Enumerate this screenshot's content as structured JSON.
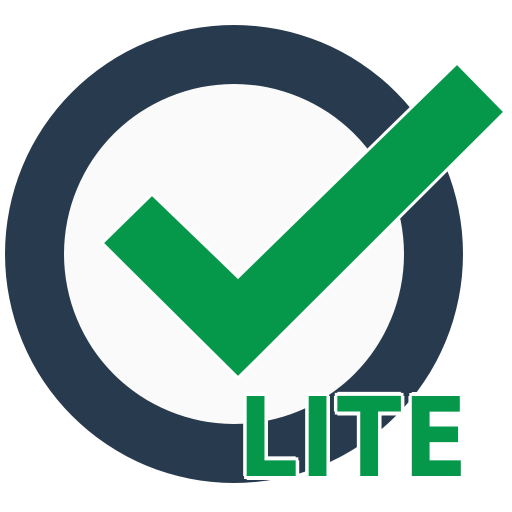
{
  "app_icon": {
    "badge_text": "LITE",
    "icon_names": [
      "ring-icon",
      "checkmark-icon"
    ]
  },
  "colors": {
    "ring": "#283a4e",
    "ring_inner": "#fafafa",
    "checkmark": "#06984a",
    "badge_text": "#06984a",
    "background": "#ffffff"
  }
}
